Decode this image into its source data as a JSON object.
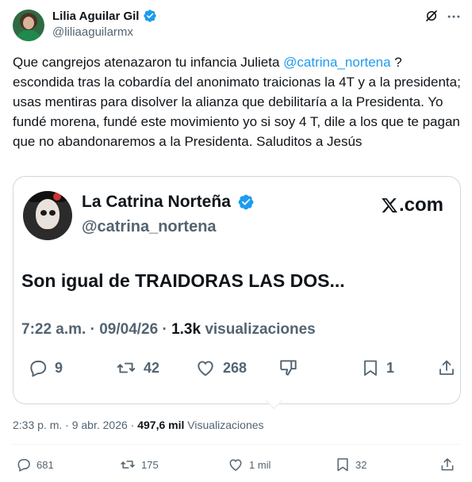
{
  "author": {
    "name": "Lilia Aguilar Gil",
    "handle": "@liliaaguilarmx"
  },
  "post": {
    "text_before": "Que cangrejos atenazaron tu infancia Julieta ",
    "mention": "@catrina_nortena",
    "text_after": " ? escondida tras la cobardía del anonimato traicionas la 4T y a la presidenta; usas mentiras para disolver la alianza que debilitaría a la Presidenta. Yo fundé morena, fundé este movimiento yo si soy 4 T, dile a los que te pagan que no abandonaremos a la Presidenta. Saluditos a Jesús"
  },
  "quoted": {
    "name": "La Catrina Norteña",
    "handle": "@catrina_nortena",
    "site": ".com",
    "text": "Son igual de TRAIDORAS LAS DOS...",
    "time": "7:22 a.m.",
    "sep1": " · ",
    "date": "09/04/26",
    "sep2": " · ",
    "views_count": "1.3k",
    "views_label": " visualizaciones",
    "replies": "9",
    "reposts": "42",
    "likes": "268",
    "bookmarks": "1"
  },
  "meta": {
    "time": "2:33 p. m.",
    "sep1": " · ",
    "date": "9 abr. 2026",
    "sep2": " · ",
    "views": "497,6 mil",
    "views_label": " Visualizaciones"
  },
  "actions": {
    "replies": "681",
    "reposts": "175",
    "likes": "1 mil",
    "bookmarks": "32"
  },
  "colors": {
    "accent": "#1d9bf0",
    "text": "#0f1419",
    "muted": "#536471",
    "verified": "#1d9bf0"
  },
  "icons": [
    "verified-badge-icon",
    "grok-icon",
    "more-icon",
    "reply-icon",
    "repost-icon",
    "like-icon",
    "dislike-icon",
    "bookmark-icon",
    "share-icon",
    "x-logo-icon"
  ]
}
